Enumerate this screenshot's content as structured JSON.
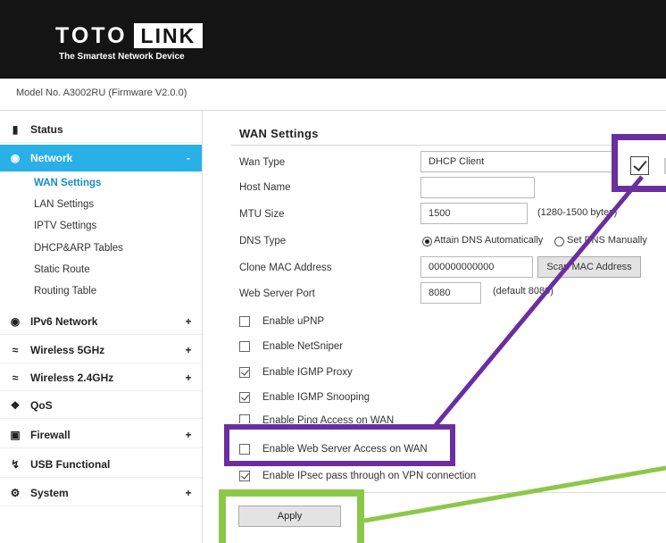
{
  "header": {
    "brand_part1": "TOTO",
    "brand_part2": "LINK",
    "tagline": "The Smartest Network Device"
  },
  "model_line": "Model No. A3002RU (Firmware V2.0.0)",
  "sidebar": {
    "items": [
      {
        "icon": "chat-bubble-icon",
        "label": "Status",
        "expander": ""
      },
      {
        "icon": "globe-icon",
        "label": "Network",
        "expander": "-"
      },
      {
        "icon": "globe-icon",
        "label": "IPv6 Network",
        "expander": "+"
      },
      {
        "icon": "wifi-icon",
        "label": "Wireless 5GHz",
        "expander": "+"
      },
      {
        "icon": "wifi-icon",
        "label": "Wireless 2.4GHz",
        "expander": "+"
      },
      {
        "icon": "qos-icon",
        "label": "QoS",
        "expander": ""
      },
      {
        "icon": "lock-icon",
        "label": "Firewall",
        "expander": "+"
      },
      {
        "icon": "usb-icon",
        "label": "USB Functional",
        "expander": ""
      },
      {
        "icon": "gear-icon",
        "label": "System",
        "expander": "+"
      }
    ],
    "network_subitems": [
      "WAN Settings",
      "LAN Settings",
      "IPTV Settings",
      "DHCP&ARP Tables",
      "Static Route",
      "Routing Table"
    ]
  },
  "main": {
    "title": "WAN Settings",
    "wan_type": {
      "label": "Wan Type",
      "value": "DHCP Client"
    },
    "host_name": {
      "label": "Host Name",
      "value": ""
    },
    "mtu": {
      "label": "MTU Size",
      "value": "1500",
      "hint": "(1280-1500 bytes)"
    },
    "dns": {
      "label": "DNS Type",
      "option_auto": "Attain DNS Automatically",
      "option_manual": "Set DNS Manually",
      "selected": "auto"
    },
    "clone_mac": {
      "label": "Clone MAC Address",
      "value": "000000000000",
      "button": "Scan MAC Address"
    },
    "web_port": {
      "label": "Web Server Port",
      "value": "8080",
      "hint": "(default 8080)"
    },
    "checkboxes": [
      {
        "label": "Enable uPNP",
        "checked": false
      },
      {
        "label": "Enable NetSniper",
        "checked": false
      },
      {
        "label": "Enable IGMP Proxy",
        "checked": true
      },
      {
        "label": "Enable IGMP Snooping",
        "checked": true
      },
      {
        "label": "Enable Ping Access on WAN",
        "checked": false
      },
      {
        "label": "Enable Web Server Access on WAN",
        "checked": false
      },
      {
        "label": "Enable IPsec pass through on VPN connection",
        "checked": true
      }
    ],
    "apply_label": "Apply"
  },
  "annotation_colors": {
    "purple": "#6a2ea0",
    "green": "#8bc84a",
    "accent": "#29b0e6"
  }
}
